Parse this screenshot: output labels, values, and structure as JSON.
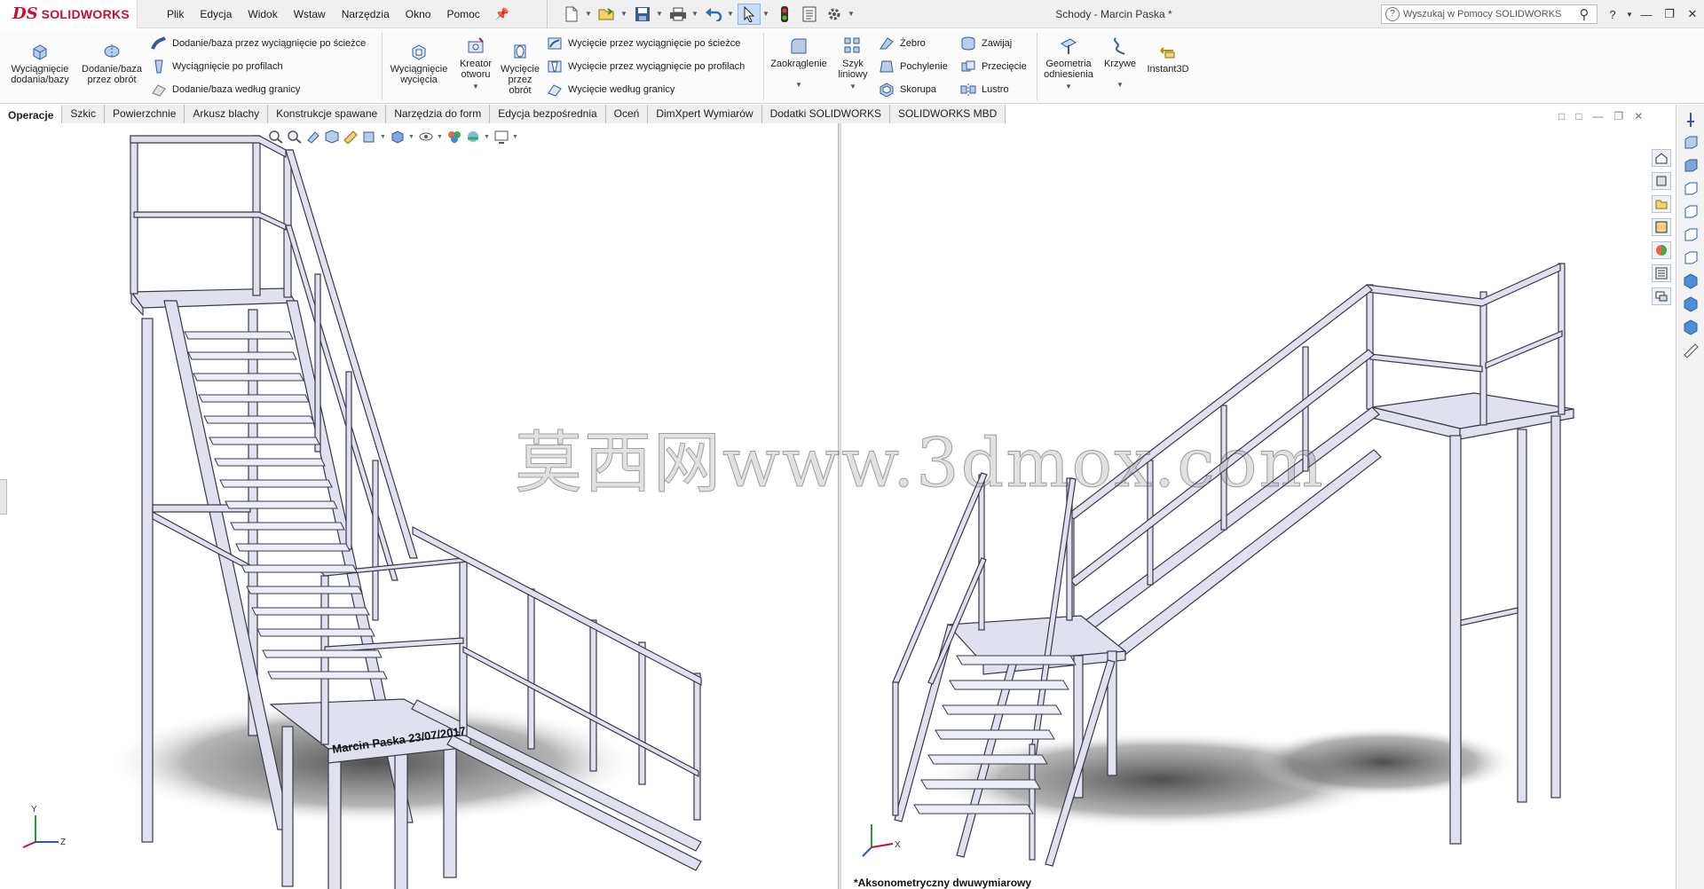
{
  "app": {
    "logo_mark": "DS",
    "logo_text": "SOLIDWORKS"
  },
  "menu": [
    "Plik",
    "Edycja",
    "Widok",
    "Wstaw",
    "Narzędzia",
    "Okno",
    "Pomoc"
  ],
  "document_title": "Schody - Marcin Paska *",
  "search": {
    "placeholder": "Wyszukaj w Pomocy SOLIDWORKS"
  },
  "ribbon": {
    "extrude_boss": "Wyciągnięcie dodania/bazy",
    "revolve_boss": "Dodanie/baza przez obrót",
    "swept_boss": "Dodanie/baza przez wyciągnięcie po ścieżce",
    "lofted_boss": "Wyciągnięcie po profilach",
    "boundary_boss": "Dodanie/baza według granicy",
    "extruded_cut": "Wyciągnięcie wycięcia",
    "hole_wizard": "Kreator otworu",
    "revolved_cut": "Wycięcie przez obrót",
    "swept_cut": "Wycięcie przez wyciągnięcie po ścieżce",
    "lofted_cut": "Wycięcie przez wyciągnięcie po profilach",
    "boundary_cut": "Wycięcie według granicy",
    "fillet": "Zaokrąglenie",
    "linear_pattern": "Szyk liniowy",
    "rib": "Żebro",
    "draft": "Pochylenie",
    "shell": "Skorupa",
    "wrap": "Zawijaj",
    "intersect": "Przecięcie",
    "mirror": "Lustro",
    "reference_geometry": "Geometria odniesienia",
    "curves": "Krzywe",
    "instant3d": "Instant3D"
  },
  "tabs": [
    "Operacje",
    "Szkic",
    "Powierzchnie",
    "Arkusz blachy",
    "Konstrukcje spawane",
    "Narzędzia do form",
    "Edycja bezpośrednia",
    "Oceń",
    "DimXpert Wymiarów",
    "Dodatki SOLIDWORKS",
    "SOLIDWORKS MBD"
  ],
  "active_tab": "Operacje",
  "model": {
    "nameplate": "Marcin Paska 23/07/2017"
  },
  "axes": {
    "y": "Y",
    "z": "Z",
    "x": "X"
  },
  "watermark": "莫西网www.3dmox.com",
  "right_view_label": "*Aksonometryczny dwuwymiarowy",
  "colors": {
    "brand": "#c8102e",
    "steel": "#dfe1ef",
    "steel_edge": "#3a3a46",
    "shadow": "#5b5b5b",
    "selection": "#c9ddf4"
  },
  "icons": [
    "solidworks-logo-icon",
    "pin-icon",
    "new-file-icon",
    "open-file-icon",
    "save-icon",
    "print-icon",
    "undo-icon",
    "select-icon",
    "rebuild-icon",
    "file-properties-icon",
    "options-icon",
    "help-icon",
    "search-icon",
    "minimize-icon",
    "restore-icon",
    "close-icon"
  ]
}
